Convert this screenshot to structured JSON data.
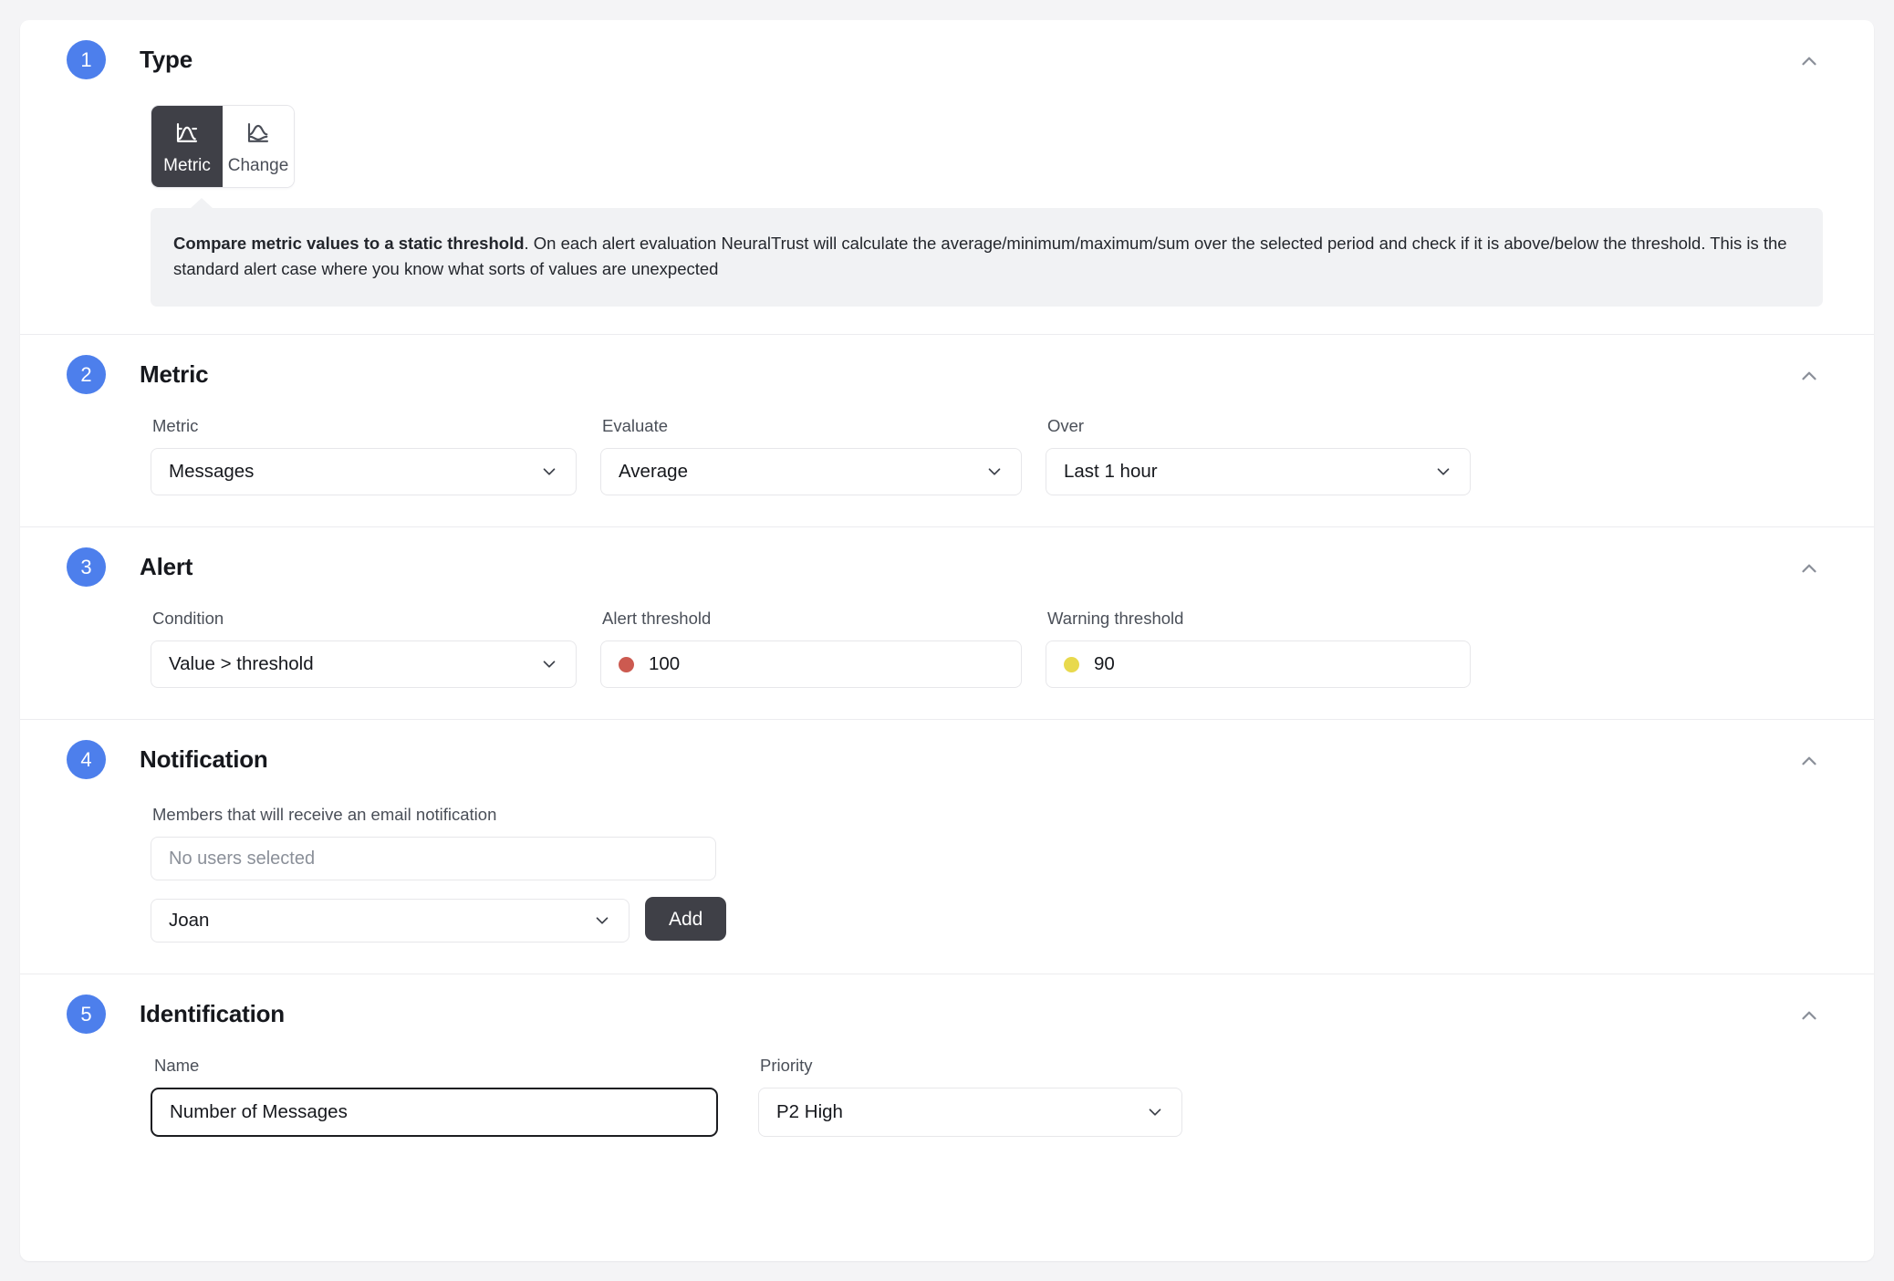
{
  "sections": [
    {
      "step": "1",
      "title": "Type",
      "collapse_icon": "chevron-up-icon",
      "type_options": [
        {
          "label": "Metric",
          "icon": "metric-chart-icon",
          "selected": true
        },
        {
          "label": "Change",
          "icon": "change-chart-icon",
          "selected": false
        }
      ],
      "callout": {
        "bold": "Compare metric values to a static threshold",
        "rest": ". On each alert evaluation NeuralTrust will calculate the average/minimum/maximum/sum over the selected period and check if it is above/below the threshold. This is the standard alert case where you know what sorts of values are unexpected"
      }
    },
    {
      "step": "2",
      "title": "Metric",
      "collapse_icon": "chevron-up-icon",
      "fields": [
        {
          "label": "Metric",
          "value": "Messages",
          "control": "select"
        },
        {
          "label": "Evaluate",
          "value": "Average",
          "control": "select"
        },
        {
          "label": "Over",
          "value": "Last 1 hour",
          "control": "select"
        }
      ]
    },
    {
      "step": "3",
      "title": "Alert",
      "collapse_icon": "chevron-up-icon",
      "fields": [
        {
          "label": "Condition",
          "value": "Value > threshold",
          "control": "select"
        },
        {
          "label": "Alert threshold",
          "value": "100",
          "control": "number",
          "dot_color": "#cc5a50"
        },
        {
          "label": "Warning threshold",
          "value": "90",
          "control": "number",
          "dot_color": "#e8d94d"
        }
      ]
    },
    {
      "step": "4",
      "title": "Notification",
      "collapse_icon": "chevron-up-icon",
      "members_label": "Members that will receive an email notification",
      "users_selected_text": "No users selected",
      "user_select_value": "Joan",
      "add_button_label": "Add"
    },
    {
      "step": "5",
      "title": "Identification",
      "collapse_icon": "chevron-up-icon",
      "fields": [
        {
          "label": "Name",
          "value": "Number of Messages",
          "control": "text"
        },
        {
          "label": "Priority",
          "value": "P2 High",
          "control": "select"
        }
      ]
    }
  ],
  "colors": {
    "step_badge": "#4d7fec",
    "segment_active_bg": "#3f4047",
    "add_button_bg": "#3f4047",
    "alert_dot": "#cc5a50",
    "warning_dot": "#e8d94d",
    "page_bg": "#f4f4f6",
    "callout_bg": "#f1f2f4",
    "focus_border": "#1c1d21"
  }
}
